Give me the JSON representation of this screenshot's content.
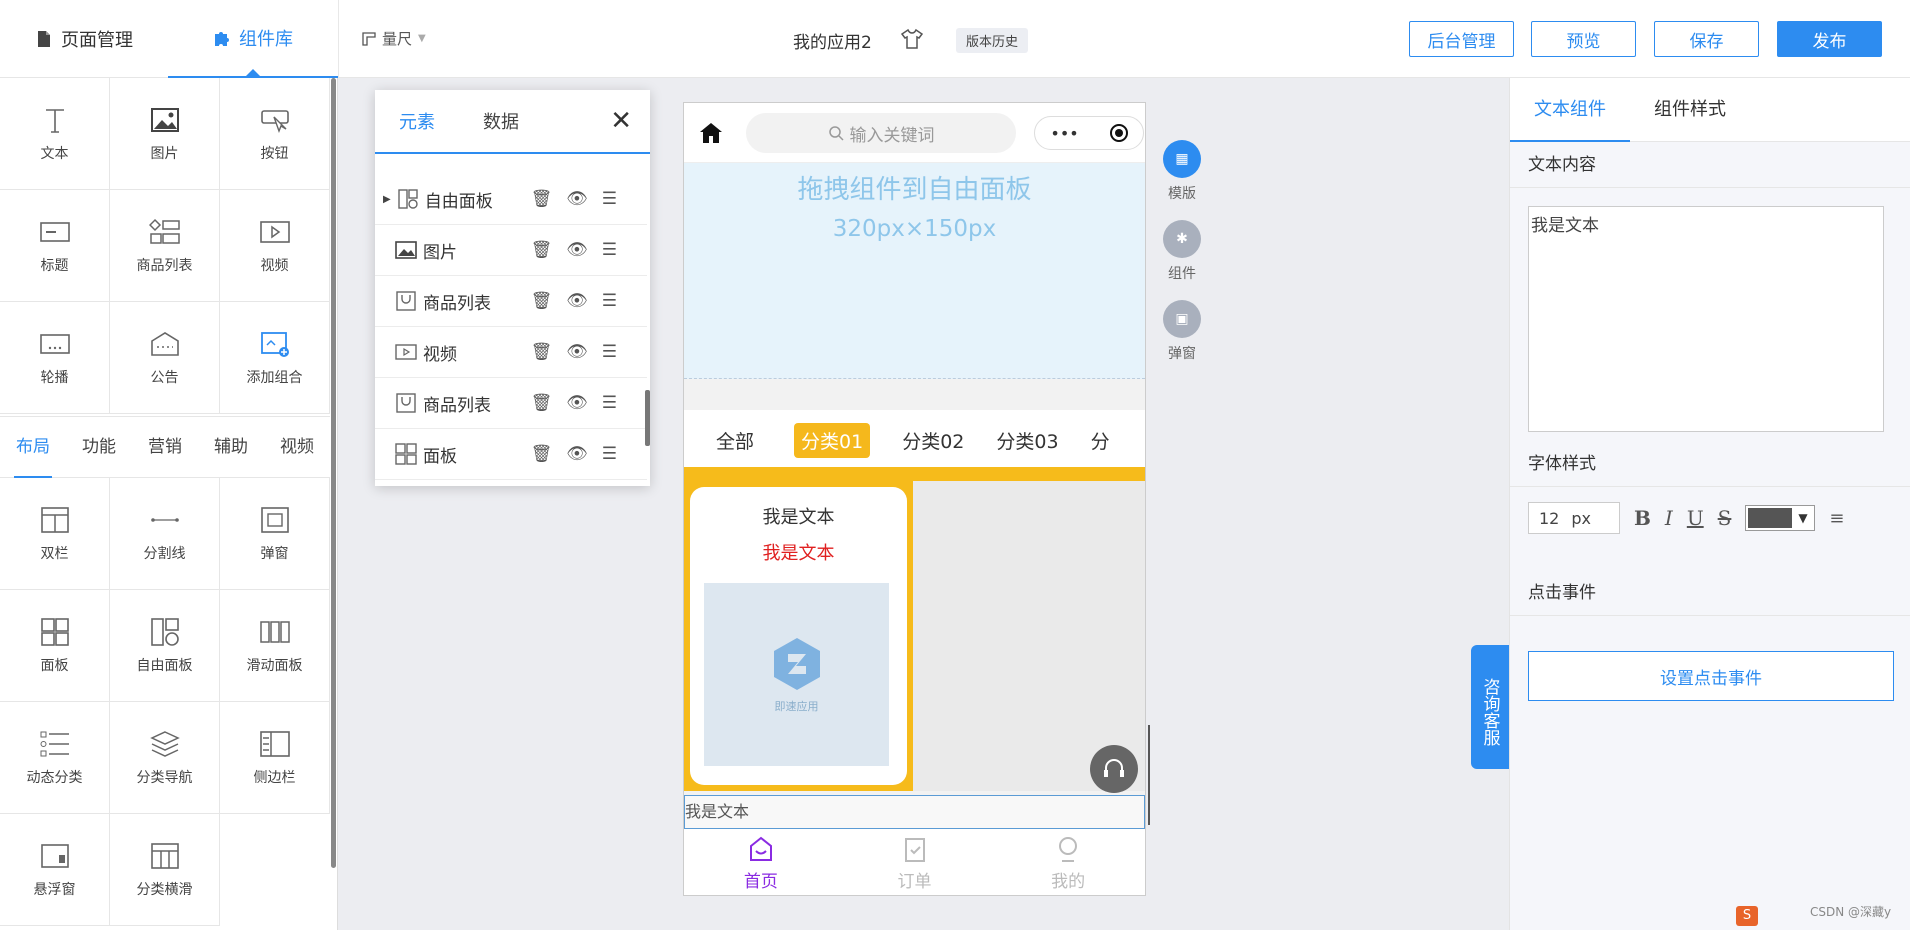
{
  "header": {
    "tab_pages": "页面管理",
    "tab_components": "组件库",
    "ruler": "量尺",
    "app_title": "我的应用2",
    "version_history": "版本历史",
    "btn_admin": "后台管理",
    "btn_preview": "预览",
    "btn_save": "保存",
    "btn_publish": "发布"
  },
  "components": {
    "grid_top": [
      {
        "label": "文本",
        "icon": "text-icon"
      },
      {
        "label": "图片",
        "icon": "image-icon"
      },
      {
        "label": "按钮",
        "icon": "button-icon"
      },
      {
        "label": "标题",
        "icon": "title-icon"
      },
      {
        "label": "商品列表",
        "icon": "product-list-icon"
      },
      {
        "label": "视频",
        "icon": "video-icon"
      },
      {
        "label": "轮播",
        "icon": "carousel-icon"
      },
      {
        "label": "公告",
        "icon": "notice-icon"
      },
      {
        "label": "添加组合",
        "icon": "add-group-icon"
      }
    ],
    "categories": [
      "布局",
      "功能",
      "营销",
      "辅助",
      "视频"
    ],
    "active_category": "布局",
    "grid_bottom": [
      {
        "label": "双栏",
        "icon": "two-column-icon"
      },
      {
        "label": "分割线",
        "icon": "divider-icon"
      },
      {
        "label": "弹窗",
        "icon": "popup-icon"
      },
      {
        "label": "面板",
        "icon": "panel-icon"
      },
      {
        "label": "自由面板",
        "icon": "free-panel-icon"
      },
      {
        "label": "滑动面板",
        "icon": "slide-panel-icon"
      },
      {
        "label": "动态分类",
        "icon": "dynamic-category-icon"
      },
      {
        "label": "分类导航",
        "icon": "category-nav-icon"
      },
      {
        "label": "侧边栏",
        "icon": "sidebar-icon"
      },
      {
        "label": "悬浮窗",
        "icon": "float-window-icon"
      },
      {
        "label": "分类横滑",
        "icon": "category-slide-icon"
      }
    ]
  },
  "layers": {
    "tab_elements": "元素",
    "tab_data": "数据",
    "rows": [
      {
        "label": "自由面板",
        "icon": "free-panel-icon"
      },
      {
        "label": "图片",
        "icon": "image-icon"
      },
      {
        "label": "商品列表",
        "icon": "product-list-icon"
      },
      {
        "label": "视频",
        "icon": "video-icon"
      },
      {
        "label": "商品列表",
        "icon": "product-list-icon"
      },
      {
        "label": "面板",
        "icon": "panel-icon"
      }
    ]
  },
  "phone": {
    "search_placeholder": "输入关键词",
    "drop_hint": "拖拽组件到自由面板",
    "drop_size": "320px×150px",
    "categories": [
      "全部",
      "分类01",
      "分类02",
      "分类03",
      "分"
    ],
    "selected_category": "分类01",
    "card_text1": "我是文本",
    "card_text2": "我是文本",
    "card_logo_caption": "即速应用",
    "selected_text": "我是文本",
    "nav": [
      {
        "label": "首页",
        "icon": "home-icon"
      },
      {
        "label": "订单",
        "icon": "order-icon"
      },
      {
        "label": "我的",
        "icon": "profile-icon"
      }
    ],
    "active_nav": "首页"
  },
  "shortcuts": [
    {
      "label": "模版",
      "icon": "template-icon",
      "color": "#2d8cf0"
    },
    {
      "label": "组件",
      "icon": "puzzle-icon",
      "color": "#a9b0bd"
    },
    {
      "label": "弹窗",
      "icon": "popup-icon",
      "color": "#a9b0bd"
    }
  ],
  "right": {
    "tab_text": "文本组件",
    "tab_style": "组件样式",
    "sec_content": "文本内容",
    "text_value": "我是文本",
    "sec_font": "字体样式",
    "font_size": "12",
    "font_unit": "px",
    "fmt_bold": "B",
    "fmt_italic": "I",
    "fmt_underline": "U",
    "fmt_strike": "S",
    "text_color": "#555555",
    "sec_click": "点击事件",
    "btn_click": "设置点击事件"
  },
  "consult": "咨询客服",
  "watermark": "CSDN @深藏y",
  "colors": {
    "accent": "#2d8cf0",
    "category_highlight": "#f6bb1b",
    "active_nav": "#8a2be2"
  }
}
